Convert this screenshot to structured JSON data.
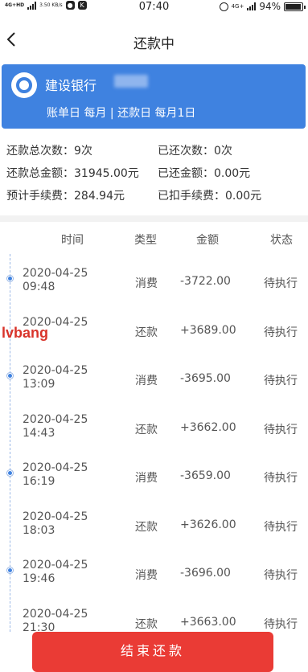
{
  "status_bar": {
    "network": "4G+HD",
    "speed": "3.50 KB/s",
    "time": "07:40",
    "network_right": "4G+",
    "battery": "94%"
  },
  "nav": {
    "title": "还款中"
  },
  "card": {
    "bank_name": "建设银行",
    "bill_line": "账单日  每月 | 还款日  每月1日"
  },
  "summary": {
    "rows": [
      {
        "left": "还款总次数：9次",
        "right": "已还次数：0次"
      },
      {
        "left": "还款总金额：31945.00元",
        "right": "已还金额：0.00元"
      },
      {
        "left": "预计手续费：284.94元",
        "right": "已扣手续费：0.00元"
      }
    ]
  },
  "table": {
    "headers": {
      "time": "时间",
      "type": "类型",
      "amount": "金额",
      "status": "状态"
    },
    "rows": [
      {
        "date": "2020-04-25",
        "time": "09:48",
        "type": "消费",
        "amount": "-3722.00",
        "status": "待执行"
      },
      {
        "date": "2020-04-25",
        "time": "",
        "type": "还款",
        "amount": "+3689.00",
        "status": "待执行"
      },
      {
        "date": "2020-04-25",
        "time": "13:09",
        "type": "消费",
        "amount": "-3695.00",
        "status": "待执行"
      },
      {
        "date": "2020-04-25",
        "time": "14:43",
        "type": "还款",
        "amount": "+3662.00",
        "status": "待执行"
      },
      {
        "date": "2020-04-25",
        "time": "16:19",
        "type": "消费",
        "amount": "-3659.00",
        "status": "待执行"
      },
      {
        "date": "2020-04-25",
        "time": "18:03",
        "type": "还款",
        "amount": "+3626.00",
        "status": "待执行"
      },
      {
        "date": "2020-04-25",
        "time": "19:46",
        "type": "消费",
        "amount": "-3696.00",
        "status": "待执行"
      },
      {
        "date": "2020-04-25",
        "time": "21:30",
        "type": "还款",
        "amount": "+3663.00",
        "status": "待执行"
      }
    ]
  },
  "watermark": "lvbang",
  "footer": {
    "end_button": "结束还款"
  },
  "colors": {
    "accent": "#3f82e0",
    "danger": "#ea3b35"
  }
}
